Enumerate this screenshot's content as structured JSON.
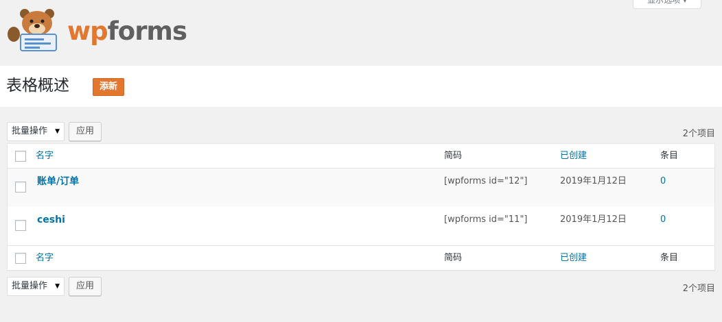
{
  "brand": {
    "logo_wp": "wp",
    "logo_forms": "forms",
    "accent": "#e27730"
  },
  "screen_options": {
    "label": "显示选项 ▾"
  },
  "page": {
    "title": "表格概述",
    "add_new_label": "添新"
  },
  "tablenav": {
    "bulk_actions_label": "批量操作",
    "apply_label": "应用",
    "item_count": "2个项目"
  },
  "table": {
    "columns": {
      "name": "名字",
      "shortcode": "简码",
      "created": "已创建",
      "entries": "条目"
    },
    "rows": [
      {
        "name": "账单/订单",
        "shortcode": "[wpforms id=\"12\"]",
        "created": "2019年1月12日",
        "entries": "0"
      },
      {
        "name": "ceshi",
        "shortcode": "[wpforms id=\"11\"]",
        "created": "2019年1月12日",
        "entries": "0"
      }
    ]
  }
}
